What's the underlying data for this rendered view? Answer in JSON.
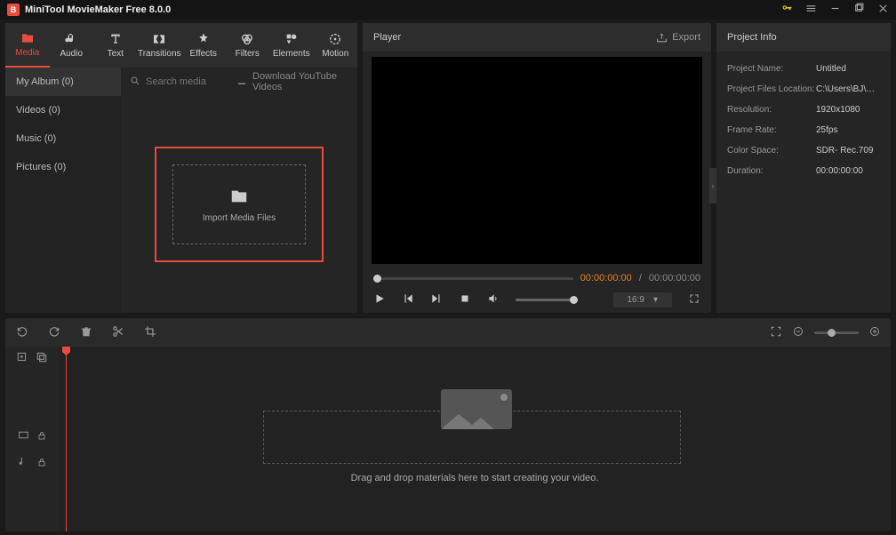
{
  "app": {
    "title": "MiniTool MovieMaker Free 8.0.0"
  },
  "tabs": [
    {
      "label": "Media"
    },
    {
      "label": "Audio"
    },
    {
      "label": "Text"
    },
    {
      "label": "Transitions"
    },
    {
      "label": "Effects"
    },
    {
      "label": "Filters"
    },
    {
      "label": "Elements"
    },
    {
      "label": "Motion"
    }
  ],
  "sidebar": [
    {
      "label": "My Album (0)"
    },
    {
      "label": "Videos (0)"
    },
    {
      "label": "Music (0)"
    },
    {
      "label": "Pictures (0)"
    }
  ],
  "media": {
    "search_placeholder": "Search media",
    "download_label": "Download YouTube Videos",
    "import_label": "Import Media Files"
  },
  "player": {
    "title": "Player",
    "export_label": "Export",
    "time_current": "00:00:00:00",
    "time_total": "00:00:00:00",
    "aspect": "16:9"
  },
  "info": {
    "title": "Project Info",
    "rows": [
      {
        "label": "Project Name:",
        "value": "Untitled"
      },
      {
        "label": "Project Files Location:",
        "value": "C:\\Users\\BJ\\App..."
      },
      {
        "label": "Resolution:",
        "value": "1920x1080"
      },
      {
        "label": "Frame Rate:",
        "value": "25fps"
      },
      {
        "label": "Color Space:",
        "value": "SDR- Rec.709"
      },
      {
        "label": "Duration:",
        "value": "00:00:00:00"
      }
    ]
  },
  "timeline": {
    "drop_hint": "Drag and drop materials here to start creating your video."
  }
}
